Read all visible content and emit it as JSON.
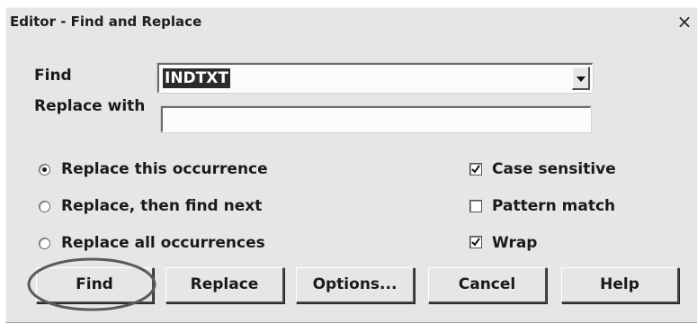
{
  "window": {
    "title": "Editor - Find and Replace",
    "close_glyph": "×"
  },
  "fields": {
    "find_label": "Find",
    "find_value": "INDTXT",
    "replace_label": "Replace with",
    "replace_value": ""
  },
  "options": {
    "radios": [
      {
        "label": "Replace this occurrence",
        "selected": true
      },
      {
        "label": "Replace, then find next",
        "selected": false
      },
      {
        "label": "Replace all occurrences",
        "selected": false
      }
    ],
    "checkboxes": [
      {
        "label": "Case sensitive",
        "checked": true
      },
      {
        "label": "Pattern match",
        "checked": false
      },
      {
        "label": "Wrap",
        "checked": true
      }
    ]
  },
  "buttons": {
    "find": "Find",
    "replace": "Replace",
    "options": "Options...",
    "cancel": "Cancel",
    "help": "Help"
  },
  "icons": {
    "dropdown": "chevron-down-icon",
    "close": "close-icon",
    "annotation": "highlight-ellipse"
  },
  "colors": {
    "dialog_bg": "#e6e6e6",
    "selection_bg": "#2b2b2b",
    "annotation": "#5a5a5a"
  }
}
